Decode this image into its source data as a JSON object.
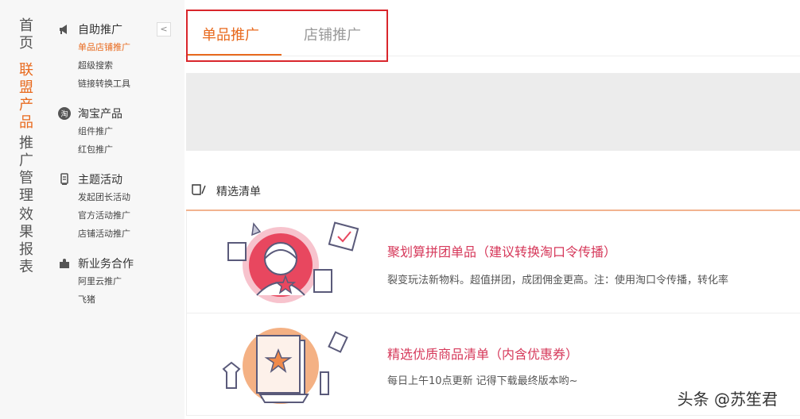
{
  "left_nav": {
    "items": [
      {
        "label_chars": [
          "首",
          "页"
        ]
      },
      {
        "label_chars": [
          "联",
          "盟",
          "产",
          "品"
        ]
      },
      {
        "label_chars": [
          "推",
          "广",
          "管",
          "理"
        ]
      },
      {
        "label_chars": [
          "效",
          "果",
          "报",
          "表"
        ]
      }
    ]
  },
  "menu": {
    "sections": [
      {
        "title": "自助推广",
        "icon": "megaphone-icon",
        "links": [
          "单品店铺推广",
          "超级搜索",
          "链接转换工具"
        ]
      },
      {
        "title": "淘宝产品",
        "icon": "taobao-icon",
        "links": [
          "组件推广",
          "红包推广"
        ]
      },
      {
        "title": "主题活动",
        "icon": "flag-icon",
        "links": [
          "发起团长活动",
          "官方活动推广",
          "店铺活动推广"
        ]
      },
      {
        "title": "新业务合作",
        "icon": "puzzle-icon",
        "links": [
          "阿里云推广",
          "飞猪"
        ]
      }
    ],
    "collapse_label": "<"
  },
  "tabs": {
    "active": "单品推广",
    "inactive": "店铺推广"
  },
  "section": {
    "title": "精选清单",
    "icon": "list-icon"
  },
  "cards": [
    {
      "title": "聚划算拼团单品（建议转换淘口令传播）",
      "desc": "裂变玩法新物料。超值拼团，成团佣金更高。注：使用淘口令传播，转化率"
    },
    {
      "title": "精选优质商品清单（内含优惠券）",
      "desc": "每日上午10点更新 记得下载最终版本哟~"
    }
  ],
  "watermark": "头条 @苏笙君",
  "colors": {
    "accent": "#e86a1e",
    "highlight_border": "#d9262c",
    "card_title": "#d6385a"
  }
}
